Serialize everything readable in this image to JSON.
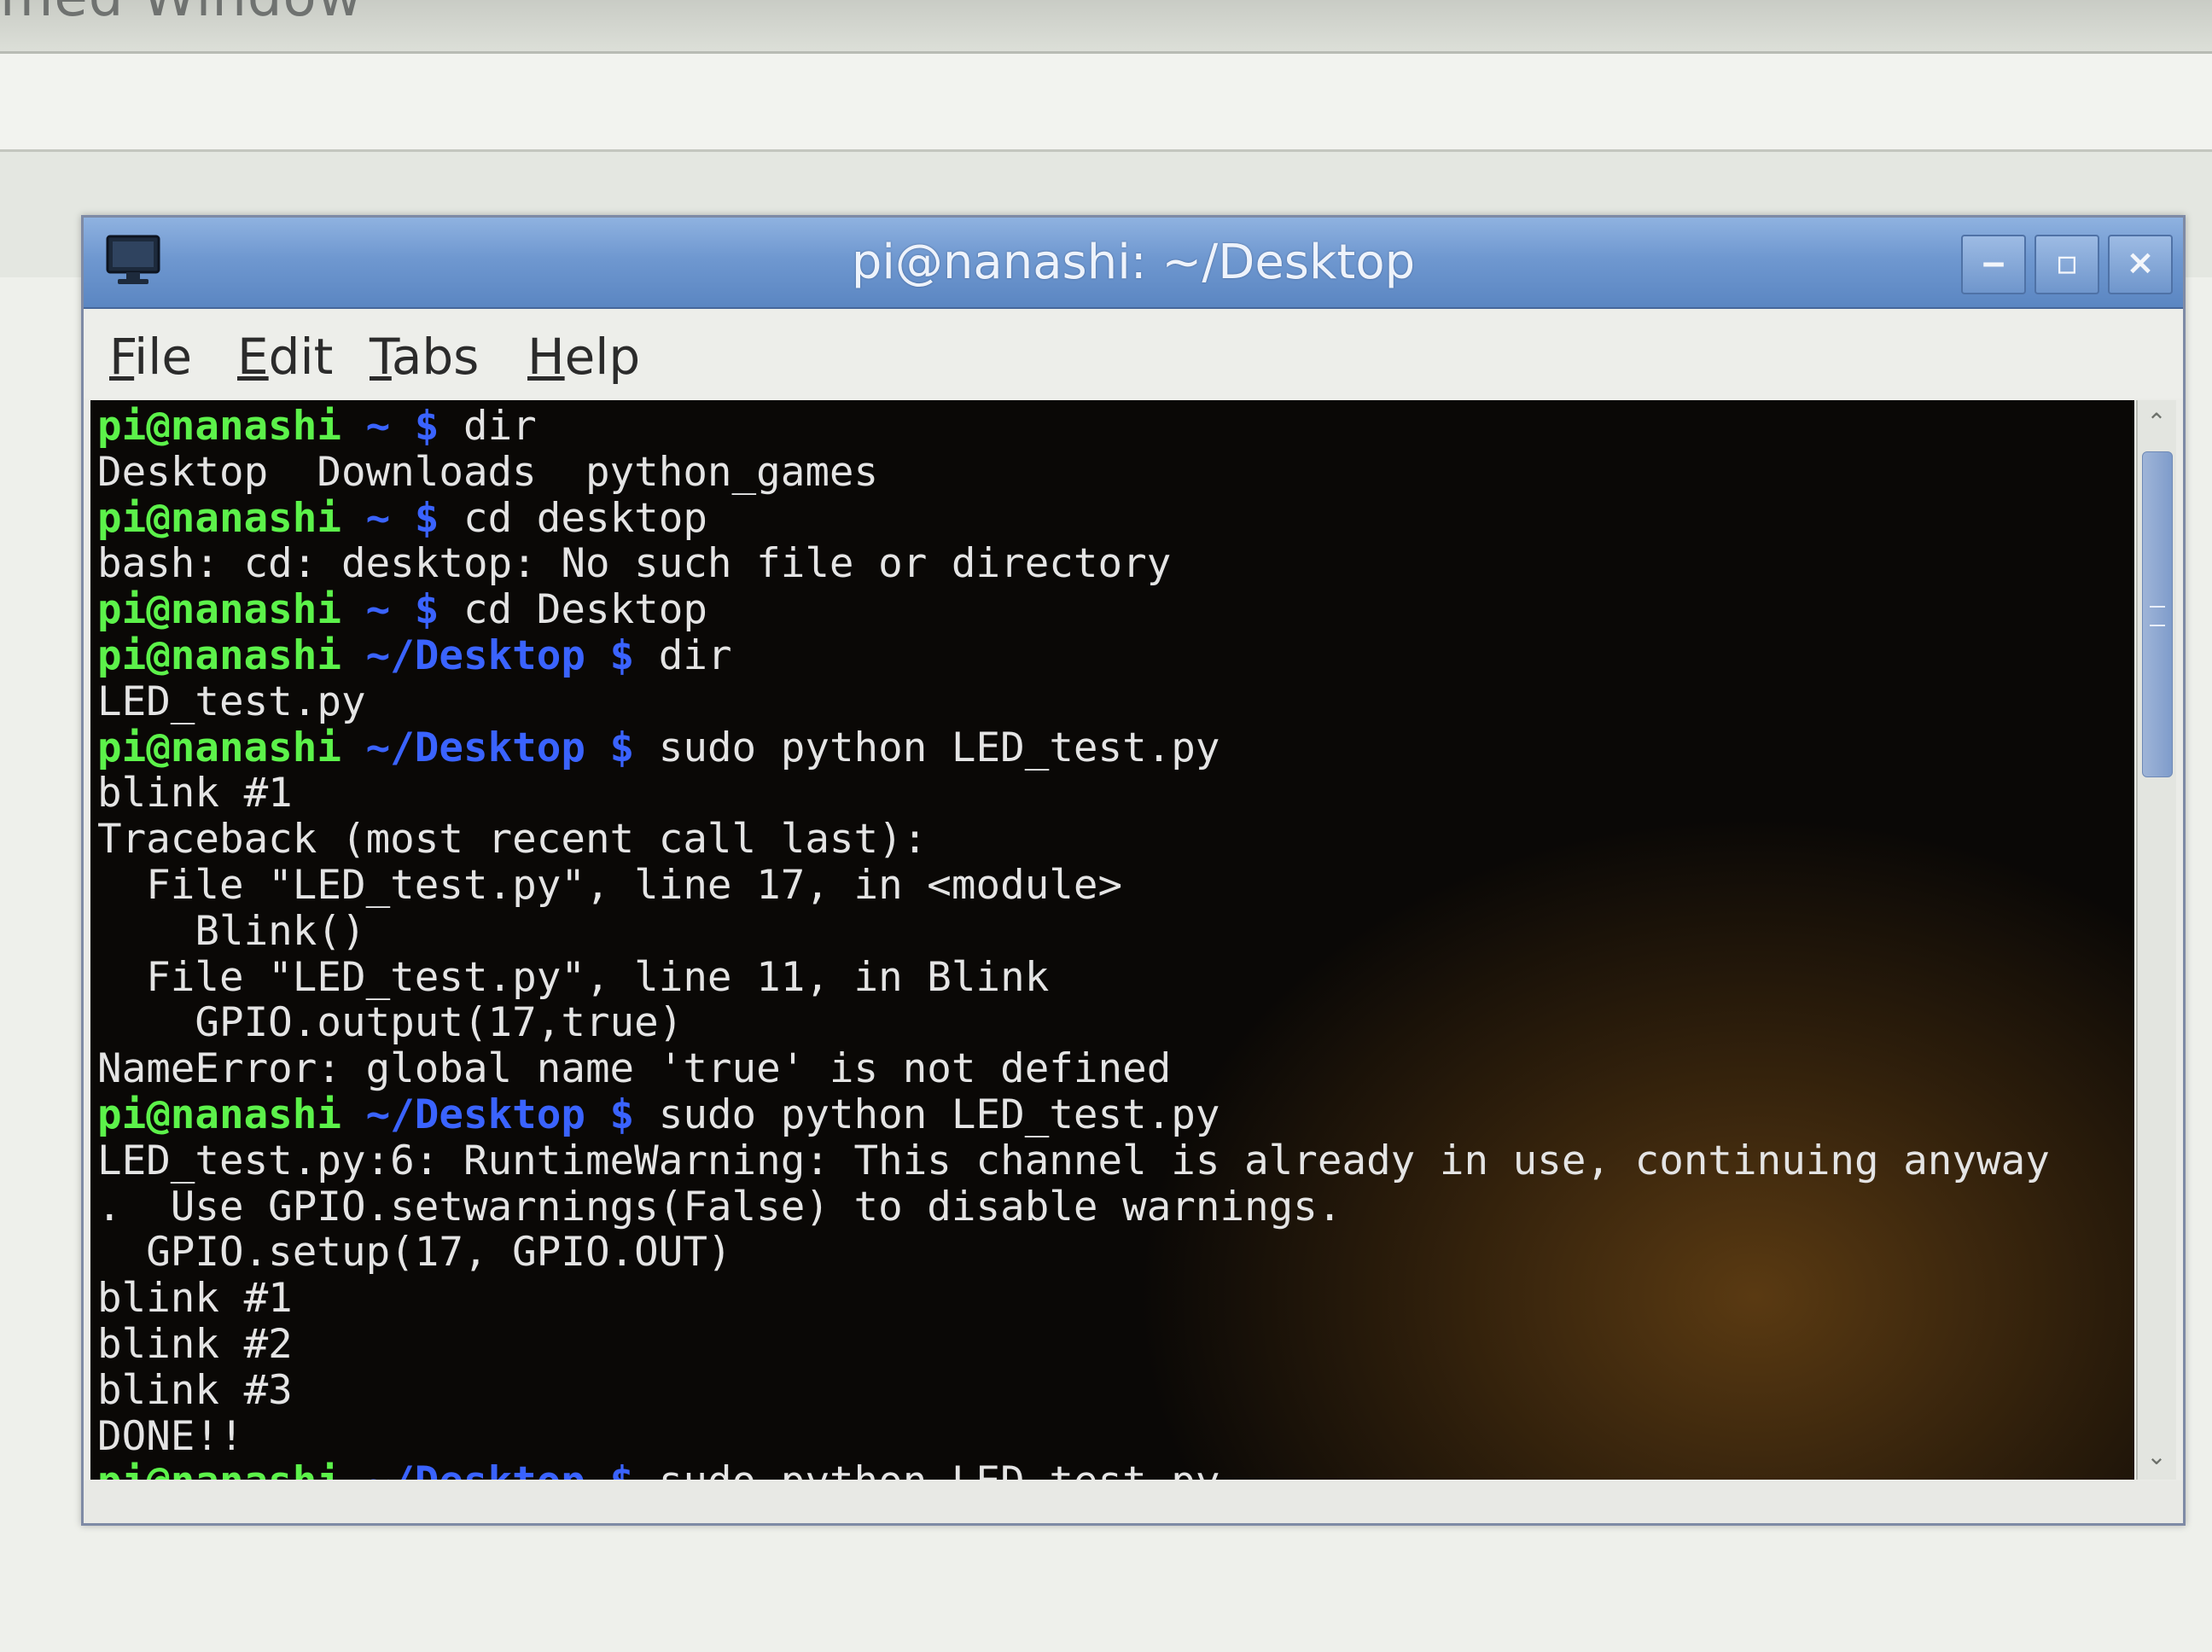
{
  "background_window": {
    "title_fragment": "med Window"
  },
  "window": {
    "title": "pi@nanashi: ~/Desktop",
    "buttons": {
      "minimize": "‒",
      "maximize": "▫",
      "close": "×"
    }
  },
  "menu": [
    {
      "mnemonic": "F",
      "rest": "ile"
    },
    {
      "mnemonic": "E",
      "rest": "dit"
    },
    {
      "mnemonic": "T",
      "rest": "abs"
    },
    {
      "mnemonic": "H",
      "rest": "elp"
    }
  ],
  "terminal": {
    "lines": [
      [
        {
          "t": "pi@nanashi",
          "s": "u"
        },
        {
          "t": " ~ $ ",
          "s": "p"
        },
        {
          "t": "dir",
          "s": "c"
        }
      ],
      [
        {
          "t": "Desktop  Downloads  python_games",
          "s": "c"
        }
      ],
      [
        {
          "t": "pi@nanashi",
          "s": "u"
        },
        {
          "t": " ~ $ ",
          "s": "p"
        },
        {
          "t": "cd desktop",
          "s": "c"
        }
      ],
      [
        {
          "t": "bash: cd: desktop: No such file or directory",
          "s": "c"
        }
      ],
      [
        {
          "t": "pi@nanashi",
          "s": "u"
        },
        {
          "t": " ~ $ ",
          "s": "p"
        },
        {
          "t": "cd Desktop",
          "s": "c"
        }
      ],
      [
        {
          "t": "pi@nanashi",
          "s": "u"
        },
        {
          "t": " ~/Desktop $ ",
          "s": "p"
        },
        {
          "t": "dir",
          "s": "c"
        }
      ],
      [
        {
          "t": "LED_test.py",
          "s": "c"
        }
      ],
      [
        {
          "t": "pi@nanashi",
          "s": "u"
        },
        {
          "t": " ~/Desktop $ ",
          "s": "p"
        },
        {
          "t": "sudo python LED_test.py",
          "s": "c"
        }
      ],
      [
        {
          "t": "blink #1",
          "s": "c"
        }
      ],
      [
        {
          "t": "Traceback (most recent call last):",
          "s": "c"
        }
      ],
      [
        {
          "t": "  File \"LED_test.py\", line 17, in <module>",
          "s": "c"
        }
      ],
      [
        {
          "t": "    Blink()",
          "s": "c"
        }
      ],
      [
        {
          "t": "  File \"LED_test.py\", line 11, in Blink",
          "s": "c"
        }
      ],
      [
        {
          "t": "    GPIO.output(17,true)",
          "s": "c"
        }
      ],
      [
        {
          "t": "NameError: global name 'true' is not defined",
          "s": "c"
        }
      ],
      [
        {
          "t": "pi@nanashi",
          "s": "u"
        },
        {
          "t": " ~/Desktop $ ",
          "s": "p"
        },
        {
          "t": "sudo python LED_test.py",
          "s": "c"
        }
      ],
      [
        {
          "t": "LED_test.py:6: RuntimeWarning: This channel is already in use, continuing anyway",
          "s": "c"
        }
      ],
      [
        {
          "t": ".  Use GPIO.setwarnings(False) to disable warnings.",
          "s": "c"
        }
      ],
      [
        {
          "t": "  GPIO.setup(17, GPIO.OUT)",
          "s": "c"
        }
      ],
      [
        {
          "t": "blink #1",
          "s": "c"
        }
      ],
      [
        {
          "t": "blink #2",
          "s": "c"
        }
      ],
      [
        {
          "t": "blink #3",
          "s": "c"
        }
      ],
      [
        {
          "t": "DONE!!",
          "s": "c"
        }
      ],
      [
        {
          "t": "pi@nanashi",
          "s": "u"
        },
        {
          "t": " ~/Desktop $ ",
          "s": "p"
        },
        {
          "t": "sudo python LED_test.py",
          "s": "c"
        }
      ]
    ]
  },
  "scrollbar": {
    "up_arrow": "⌃",
    "down_arrow": "⌄"
  },
  "colors": {
    "prompt_user": "#5cf24a",
    "prompt_path": "#3a63ff",
    "terminal_text": "#e4e4e4",
    "terminal_bg": "#070707",
    "titlebar": "#6f98d0"
  }
}
